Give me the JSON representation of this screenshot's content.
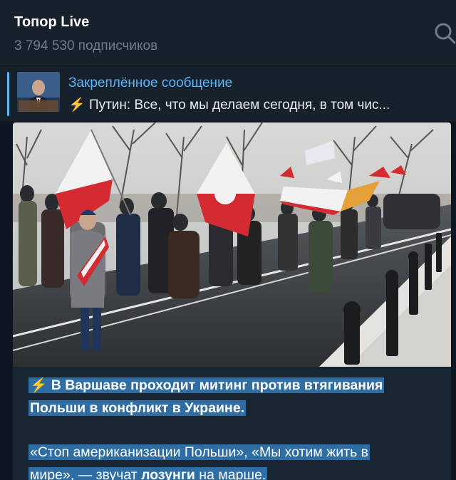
{
  "header": {
    "channel_name": "Топор Live",
    "subscribers": "3 794 530 подписчиков",
    "search_icon": "search-icon"
  },
  "pinned": {
    "title": "Закреплённое сообщение",
    "bolt": "⚡",
    "preview": "Путин: Все, что мы делаем сегодня, в том чис..."
  },
  "post": {
    "bolt": "⚡",
    "headline_part1": "В Варшаве проходит митинг против втягивания",
    "headline_part2": "Польши в конфликт в Украине.",
    "quote_part1": "«Стоп американизации Польши», «Мы хотим жить в",
    "quote_part2a": "мире», — звучат ",
    "quote_bold": "лозунги",
    "quote_part2b": " на марше."
  },
  "colors": {
    "accent": "#5eb5f7",
    "highlight": "#2f6ea5",
    "background": "#0e1621",
    "header": "#17212b"
  }
}
